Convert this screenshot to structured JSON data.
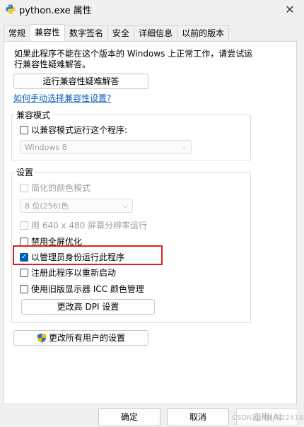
{
  "window": {
    "title": "python.exe 属性",
    "close_label": "✕"
  },
  "tabs": [
    {
      "label": "常规"
    },
    {
      "label": "兼容性"
    },
    {
      "label": "数字签名"
    },
    {
      "label": "安全"
    },
    {
      "label": "详细信息"
    },
    {
      "label": "以前的版本"
    }
  ],
  "active_tab": "兼容性",
  "intro_text": "如果此程序不能在这个版本的 Windows 上正常工作，请尝试运行兼容性疑难解答。",
  "troubleshooter_button": "运行兼容性疑难解答",
  "manual_link": "如何手动选择兼容性设置?",
  "compat_mode": {
    "group_label": "兼容模式",
    "checkbox_label": "以兼容模式运行这个程序:",
    "checked": false,
    "os_select_value": "Windows 8"
  },
  "settings": {
    "group_label": "设置",
    "reduced_color": {
      "label": "简化的颜色模式",
      "checked": false
    },
    "color_select_value": "8 位(256)色",
    "resolution_640": {
      "label": "用 640 x 480 屏幕分辨率运行",
      "checked": false
    },
    "disable_fullscreen": {
      "label": "禁用全屏优化",
      "checked": false
    },
    "run_as_admin": {
      "label": "以管理员身份运行此程序",
      "checked": true
    },
    "register_restart": {
      "label": "注册此程序以重新启动",
      "checked": false
    },
    "legacy_icc": {
      "label": "使用旧版显示器 ICC 颜色管理",
      "checked": false
    },
    "dpi_button": "更改高 DPI 设置"
  },
  "all_users_button": "更改所有用户的设置",
  "footer": {
    "ok": "确定",
    "cancel": "取消",
    "apply": "应用(A)"
  },
  "watermark": "CSDN @m0_52241833",
  "colors": {
    "accent": "#005fb8",
    "highlight_border": "#e02020",
    "link": "#0b5fb8"
  }
}
